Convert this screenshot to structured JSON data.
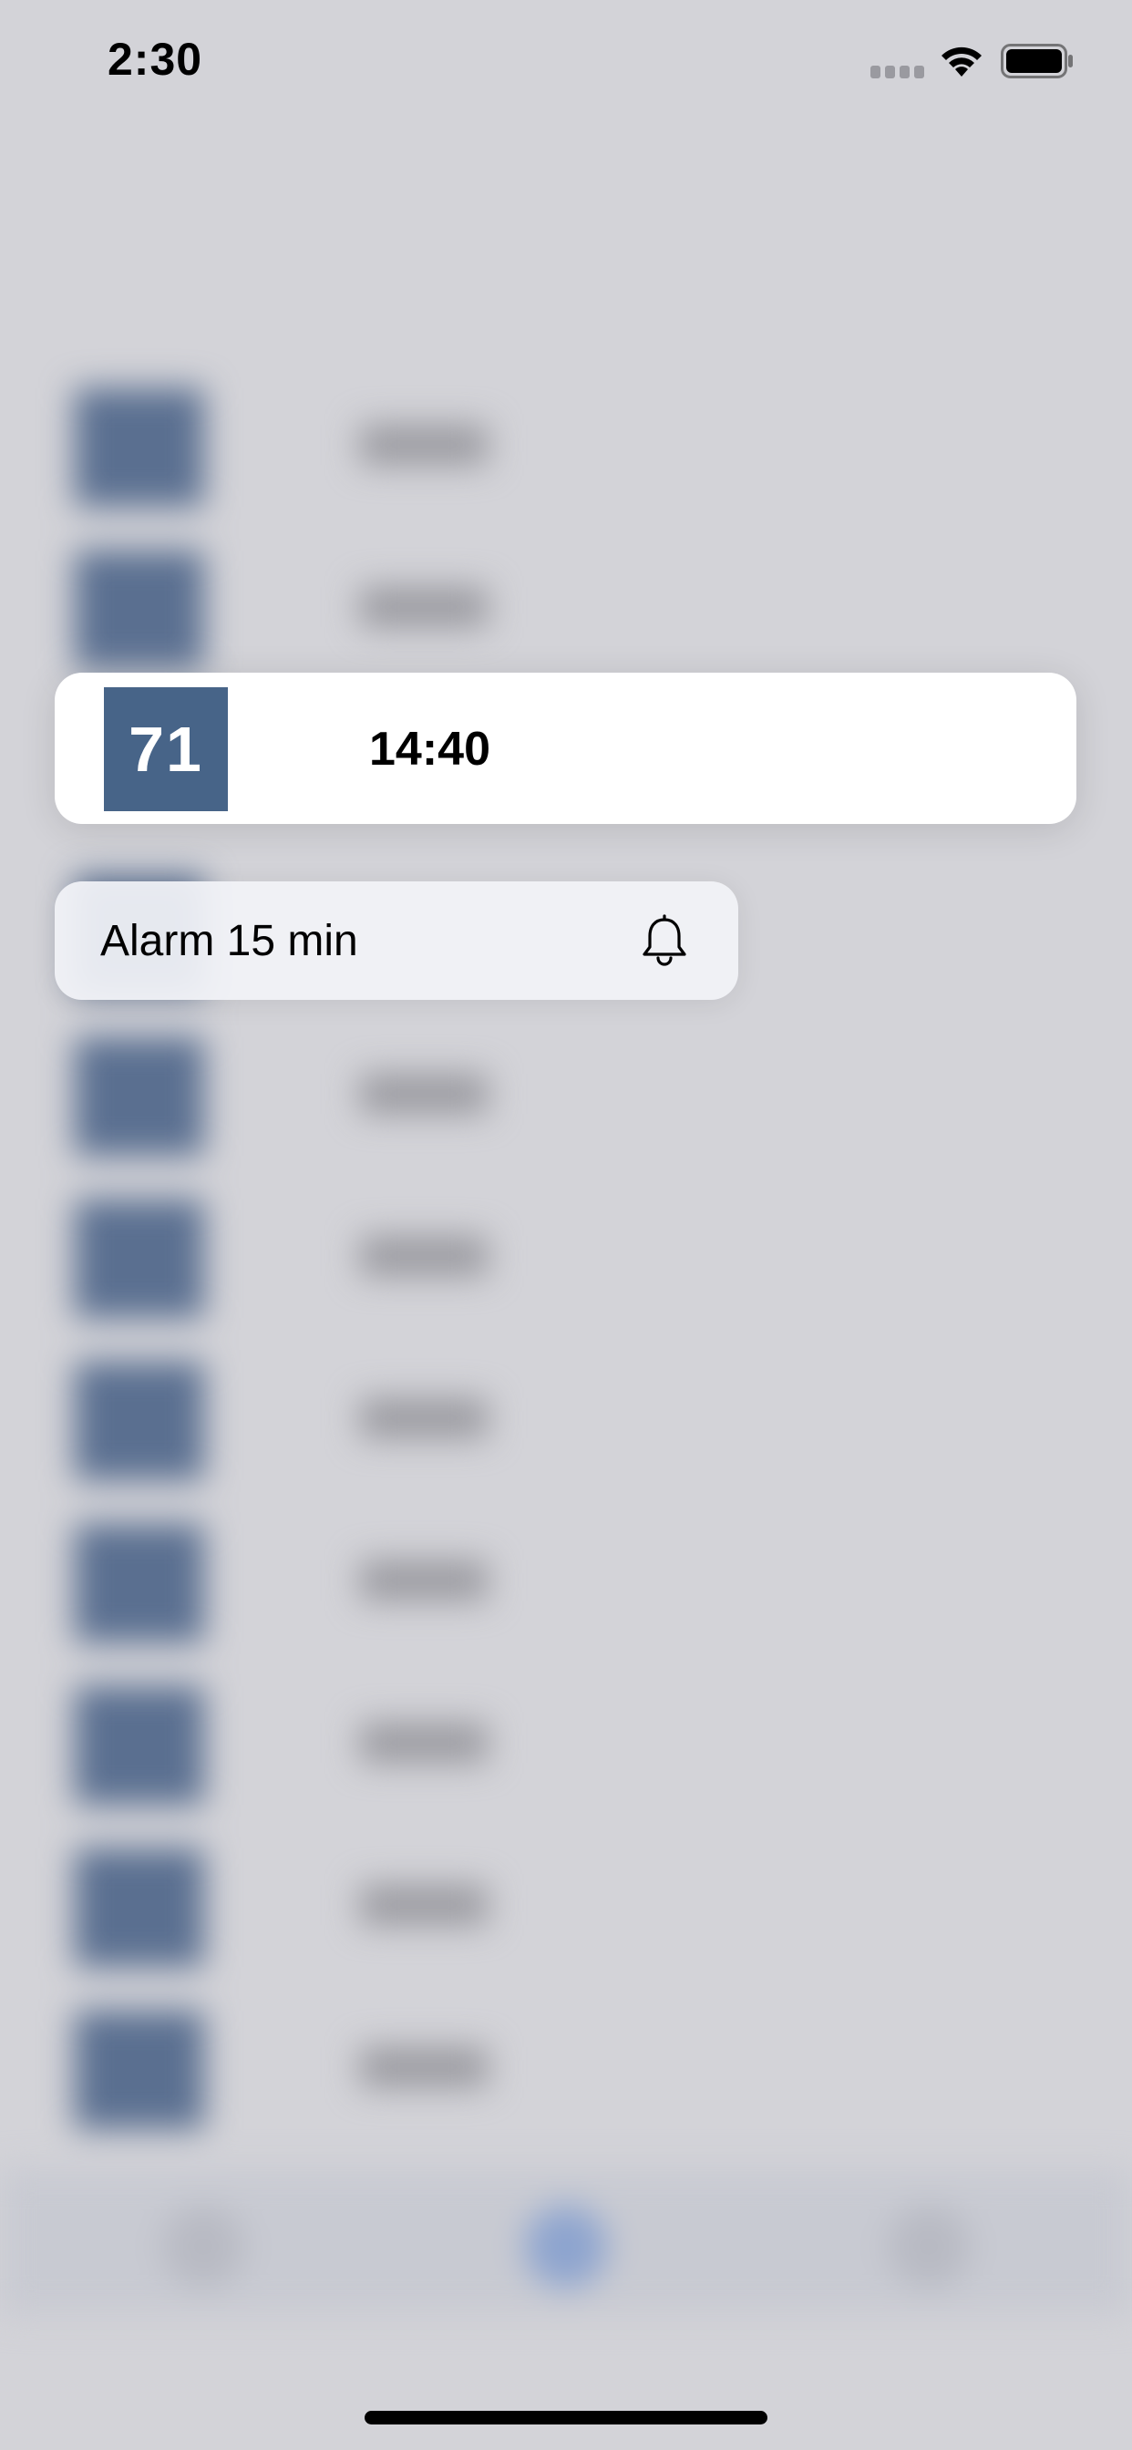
{
  "status_bar": {
    "time": "2:30",
    "signal_icon": "cellular-signal-icon",
    "wifi_icon": "wifi-icon",
    "battery_icon": "battery-full-icon"
  },
  "focused_departure": {
    "line": "71",
    "time": "14:40",
    "line_color": "#476488"
  },
  "context_menu": {
    "items": [
      {
        "label": "Alarm 15 min",
        "icon": "bell-icon"
      }
    ]
  },
  "colors": {
    "background": "#d3d3d8",
    "card": "#ffffff",
    "menu": "#f2f3f7",
    "badge": "#476488"
  }
}
